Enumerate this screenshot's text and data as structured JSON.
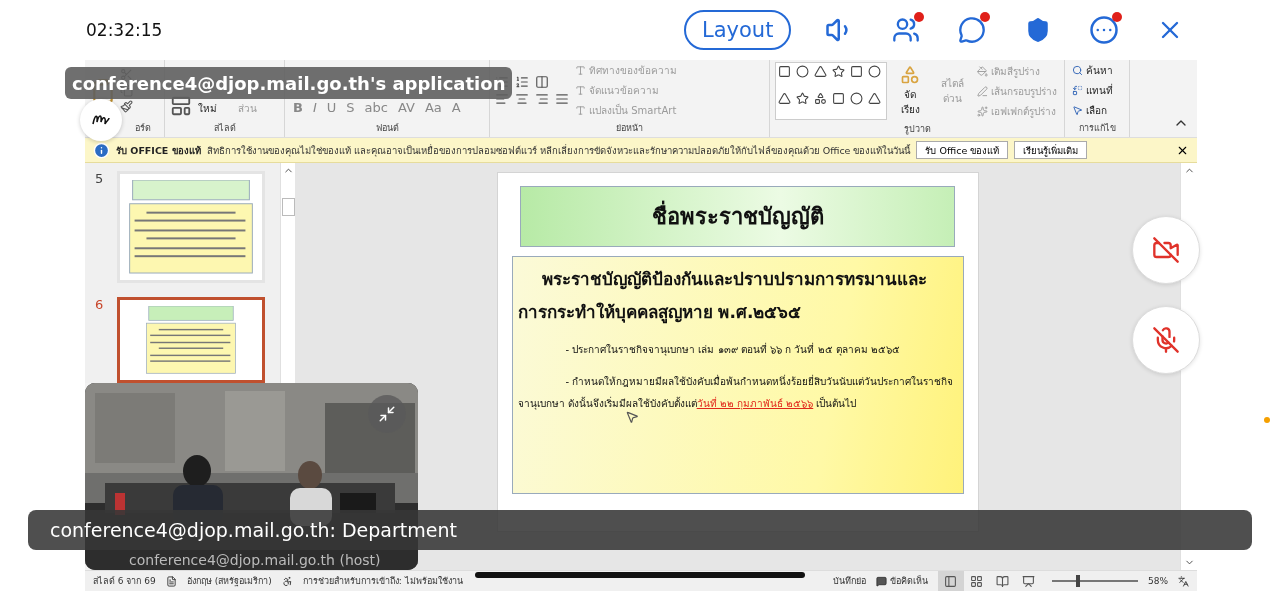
{
  "top_bar": {
    "time": "02:32:15",
    "layout_button": "Layout",
    "icons": [
      {
        "kind": "speaker",
        "badge": false
      },
      {
        "kind": "participants",
        "badge": true
      },
      {
        "kind": "chat",
        "badge": true
      },
      {
        "kind": "shield",
        "badge": false
      },
      {
        "kind": "more",
        "badge": true
      },
      {
        "kind": "close",
        "badge": false
      }
    ]
  },
  "ribbon": {
    "groups": [
      {
        "kind": "clipboard",
        "label": "อร์ด"
      },
      {
        "kind": "slides",
        "label": "สไลด์",
        "new_slide": "ใหม่",
        "section": "ส่วน"
      },
      {
        "kind": "font",
        "label": "ฟอนต์",
        "buttons": [
          "B",
          "I",
          "U",
          "S",
          "abc",
          "AV",
          "Aa",
          "A"
        ]
      },
      {
        "kind": "paragraph",
        "label": "ย่อหน้า",
        "commands": [
          {
            "label": "ทิศทางของข้อความ",
            "disabled": true
          },
          {
            "label": "จัดแนวข้อความ",
            "disabled": true
          },
          {
            "label": "แปลงเป็น SmartArt",
            "disabled": true
          }
        ]
      },
      {
        "kind": "drawing",
        "label": "รูปวาด",
        "arrange": "จัดเรียง",
        "quick_styles": "สไตล์ ด่วน",
        "commands": [
          {
            "label": "เติมสีรูปร่าง",
            "disabled": true
          },
          {
            "label": "เส้นกรอบรูปร่าง",
            "disabled": true
          },
          {
            "label": "เอฟเฟกต์รูปร่าง",
            "disabled": true
          }
        ]
      },
      {
        "kind": "editing",
        "label": "การแก้ไข",
        "commands": [
          {
            "label": "ค้นหา",
            "disabled": false
          },
          {
            "label": "แทนที่",
            "disabled": false
          },
          {
            "label": "เลือก",
            "disabled": false
          }
        ]
      }
    ]
  },
  "info_bar": {
    "title": "รับ OFFICE ของแท้",
    "message": "สิทธิการใช้งานของคุณไม่ใช่ของแท้ และคุณอาจเป็นเหยื่อของการปลอมซอฟต์แวร์ หลีกเลี่ยงการขัดจังหวะและรักษาความปลอดภัยให้กับไฟล์ของคุณด้วย Office ของแท้ในวันนี้",
    "buttons": [
      "รับ Office ของแท้",
      "เรียนรู้เพิ่มเติม"
    ]
  },
  "thumbnails": [
    {
      "number": "5",
      "selected": false
    },
    {
      "number": "6",
      "selected": true
    }
  ],
  "slide": {
    "title": "ชื่อพระราชบัญญัติ",
    "heading": "พระราชบัญญัติป้องกันและปราบปรามการทรมานและการกระทำให้บุคคลสูญหาย พ.ศ.๒๕๖๕",
    "bullets": [
      {
        "text": "- ประกาศในราชกิจจานุเบกษา เล่ม ๑๓๙ ตอนที่ ๖๖ ก วันที่ ๒๕ ตุลาคม ๒๕๖๕"
      },
      {
        "text": "- กำหนดให้กฎหมายมีผลใช้บังคับเมื่อพ้นกำหนดหนึ่งร้อยยี่สิบวันนับแต่วันประกาศในราชกิจจานุเบกษา ดังนั้นจึงเริ่มมีผลใช้บังคับตั้งแต่",
        "highlight": "วันที่ ๒๒ กุมภาพันธ์ ๒๕๖๖",
        "after": " เป็นต้นไป"
      }
    ]
  },
  "status_bar": {
    "slide_info": "สไลด์ 6 จาก 69",
    "language": "อังกฤษ (สหรัฐอเมริกา)",
    "accessibility": "การช่วยสำหรับการเข้าถึง: ไม่พร้อมใช้งาน",
    "notes": "บันทึกย่อ",
    "comments": "ข้อคิดเห็น",
    "views": [
      {
        "kind": "normal",
        "selected": true
      },
      {
        "kind": "sorter",
        "selected": false
      },
      {
        "kind": "reading",
        "selected": false
      },
      {
        "kind": "slideshow",
        "selected": false
      }
    ],
    "zoom": {
      "level": 0.28,
      "reading": "58%"
    }
  },
  "share_label": "conference4@djop.mail.go.th's application",
  "video_tile": {
    "name": "conference4@djop.mail.go.th (host)"
  },
  "caption": "conference4@djop.mail.go.th: Department",
  "floating_controls": [
    {
      "kind": "camera",
      "muted": true
    },
    {
      "kind": "mic",
      "muted": true
    }
  ]
}
